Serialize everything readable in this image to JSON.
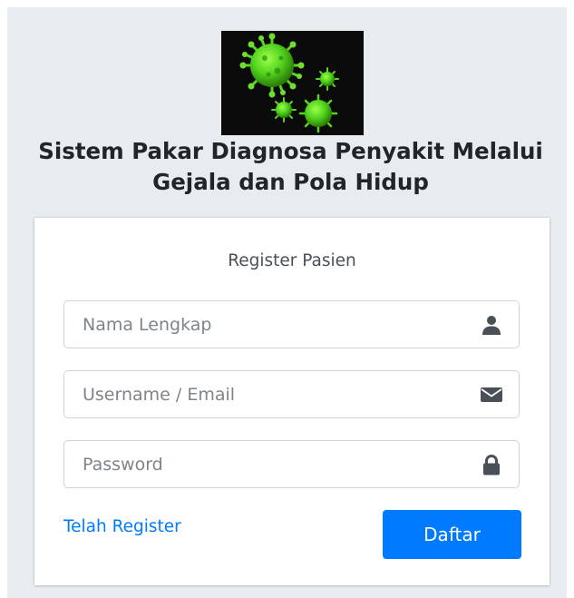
{
  "app": {
    "title": "Sistem Pakar Diagnosa Penyakit Melalui Gejala dan Pola Hidup",
    "logo_icon": "virus-icon",
    "logo_color": "#4fd11c"
  },
  "form": {
    "heading": "Register Pasien",
    "fields": [
      {
        "name": "nama",
        "placeholder": "Nama Lengkap",
        "value": "",
        "icon": "user-icon"
      },
      {
        "name": "username",
        "placeholder": "Username / Email",
        "value": "",
        "icon": "envelope-icon"
      },
      {
        "name": "password",
        "placeholder": "Password",
        "value": "",
        "icon": "lock-icon"
      }
    ],
    "login_link": "Telah Register",
    "submit_label": "Daftar"
  },
  "colors": {
    "background": "#e9ecef",
    "primary": "#007bff",
    "link": "#007bff",
    "text": "#212529"
  }
}
